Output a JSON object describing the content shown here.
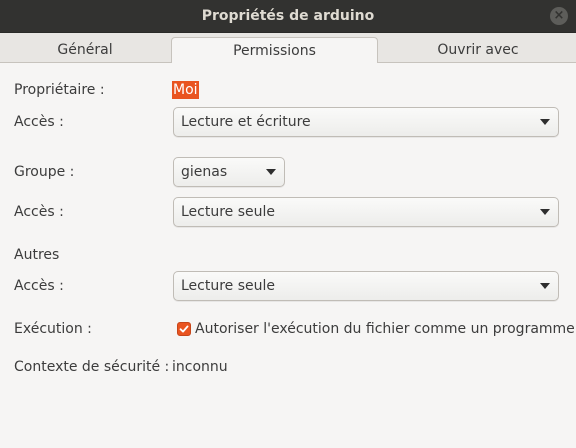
{
  "window": {
    "title": "Propriétés de arduino",
    "close_symbol": "×"
  },
  "tabs": [
    {
      "label": "Général",
      "active": false
    },
    {
      "label": "Permissions",
      "active": true
    },
    {
      "label": "Ouvrir avec",
      "active": false
    }
  ],
  "owner": {
    "label": "Propriétaire :",
    "value": "Moi",
    "access_label": "Accès :",
    "access_value": "Lecture et écriture"
  },
  "group": {
    "label": "Groupe :",
    "value": "gienas",
    "access_label": "Accès :",
    "access_value": "Lecture seule"
  },
  "others": {
    "label": "Autres",
    "access_label": "Accès :",
    "access_value": "Lecture seule"
  },
  "execution": {
    "label": "Exécution :",
    "checkbox_label": "Autoriser l'exécution du fichier comme un programme",
    "checked": true
  },
  "security": {
    "label": "Contexte de sécurité :",
    "value": "inconnu"
  },
  "colors": {
    "accent": "#e95420",
    "titlebar": "#323230",
    "background": "#f6f5f4"
  }
}
